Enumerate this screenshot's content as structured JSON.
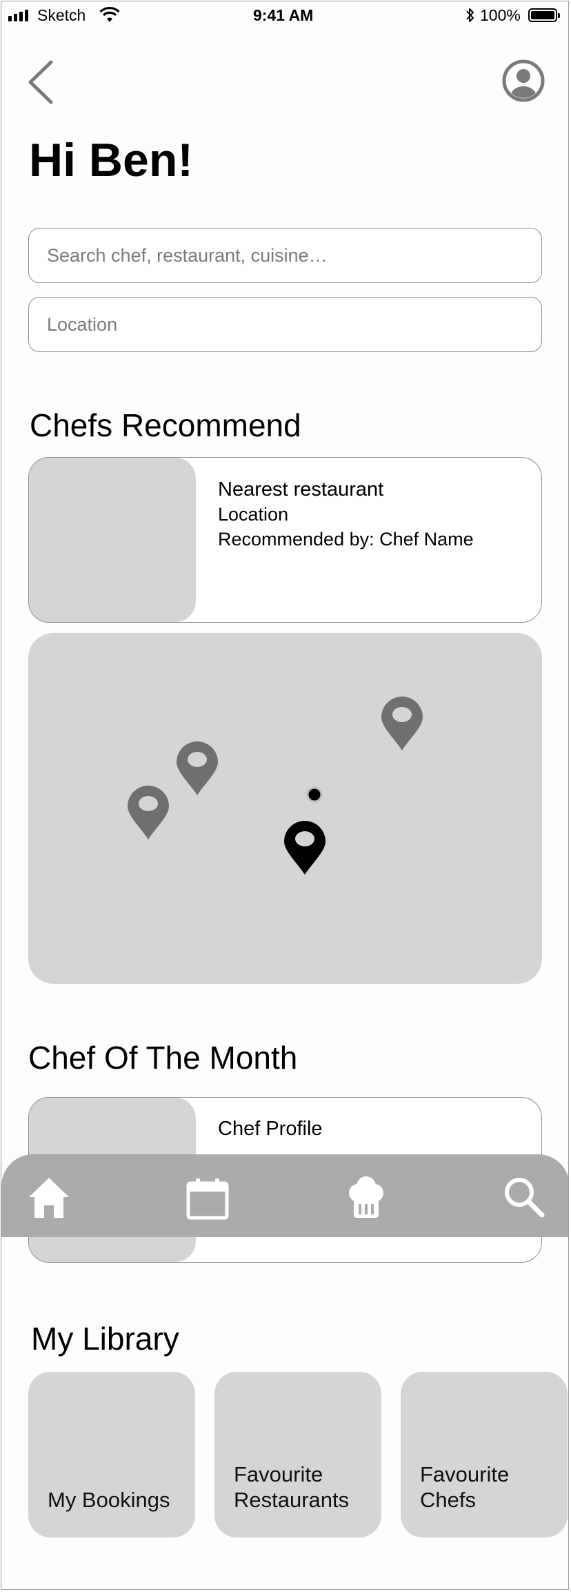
{
  "status_bar": {
    "carrier": "Sketch",
    "time": "9:41 AM",
    "battery": "100%"
  },
  "header": {
    "greeting": "Hi Ben!"
  },
  "search": {
    "placeholder": "Search chef, restaurant, cuisine…"
  },
  "location": {
    "placeholder": "Location"
  },
  "chefs_recommend": {
    "title": "Chefs Recommend",
    "card": {
      "name": "Nearest restaurant",
      "location": "Location",
      "recommended_by": "Recommended by: Chef Name"
    }
  },
  "map": {
    "pins": 4,
    "user_location_dot": true
  },
  "chef_of_month": {
    "title": "Chef Of The Month",
    "card": {
      "label": "Chef Profile"
    }
  },
  "nav": {
    "items": [
      "home-icon",
      "calendar-icon",
      "chef-hat-icon",
      "search-icon"
    ]
  },
  "library": {
    "title": "My Library",
    "tiles": [
      {
        "label": "My Bookings"
      },
      {
        "label": "Favourite Restaurants"
      },
      {
        "label": "Favourite Chefs"
      }
    ]
  },
  "colors": {
    "placeholder_gray": "#d5d5d5",
    "nav_gray": "#ababab",
    "pin_gray": "#6f6f6f",
    "pin_active": "#000000"
  }
}
